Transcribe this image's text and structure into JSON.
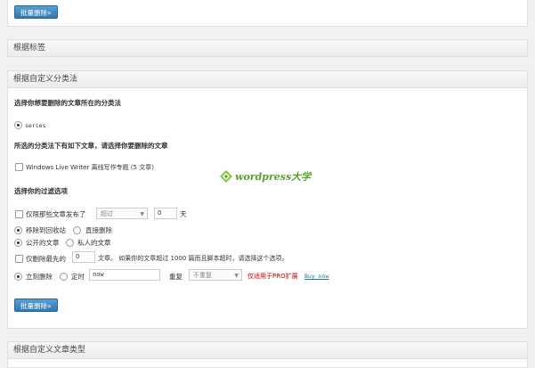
{
  "top": {
    "bulk_delete_label": "批量删除»"
  },
  "tags_section": {
    "title": "根据标签"
  },
  "taxonomy_section": {
    "title": "根据自定义分类法",
    "choose_taxonomy_heading": "选择你想要删除的文章所在的分类法",
    "taxonomy_option": "series",
    "terms_heading": "所选的分类法下有如下文章，请选择你要删除的文章",
    "term_item": "Windows Live Writer 离线写作专题 (5 文章)",
    "watermark": "wordpress大学",
    "filters_heading": "选择你的过滤选项",
    "older_than_label": "仅限那些文章发布了",
    "older_than_select": "超过",
    "older_than_value": "0",
    "days_unit": "天",
    "move_to_trash_label": "移除到回收站",
    "delete_permanently_label": "直接删除",
    "public_posts_label": "公开的文章",
    "private_posts_label": "私人的文章",
    "limit_label": "仅删除最先的",
    "limit_value": "0",
    "limit_suffix": "文章。 如果你的文章超过 1000 篇而且脚本超时，请选择这个选项。",
    "delete_now_label": "立刻删除",
    "schedule_label": "定时",
    "schedule_value": "now",
    "repeat_label": "重复",
    "repeat_select": "不重复",
    "pro_note": "仅适用于PRO扩展",
    "buy_now_link": "Buy now",
    "bulk_delete_label": "批量删除»"
  },
  "post_type_section": {
    "title": "根据自定义文章类型"
  },
  "colors": {
    "button": "#2f77b1",
    "pro_note": "#d00000",
    "link": "#21759b"
  }
}
